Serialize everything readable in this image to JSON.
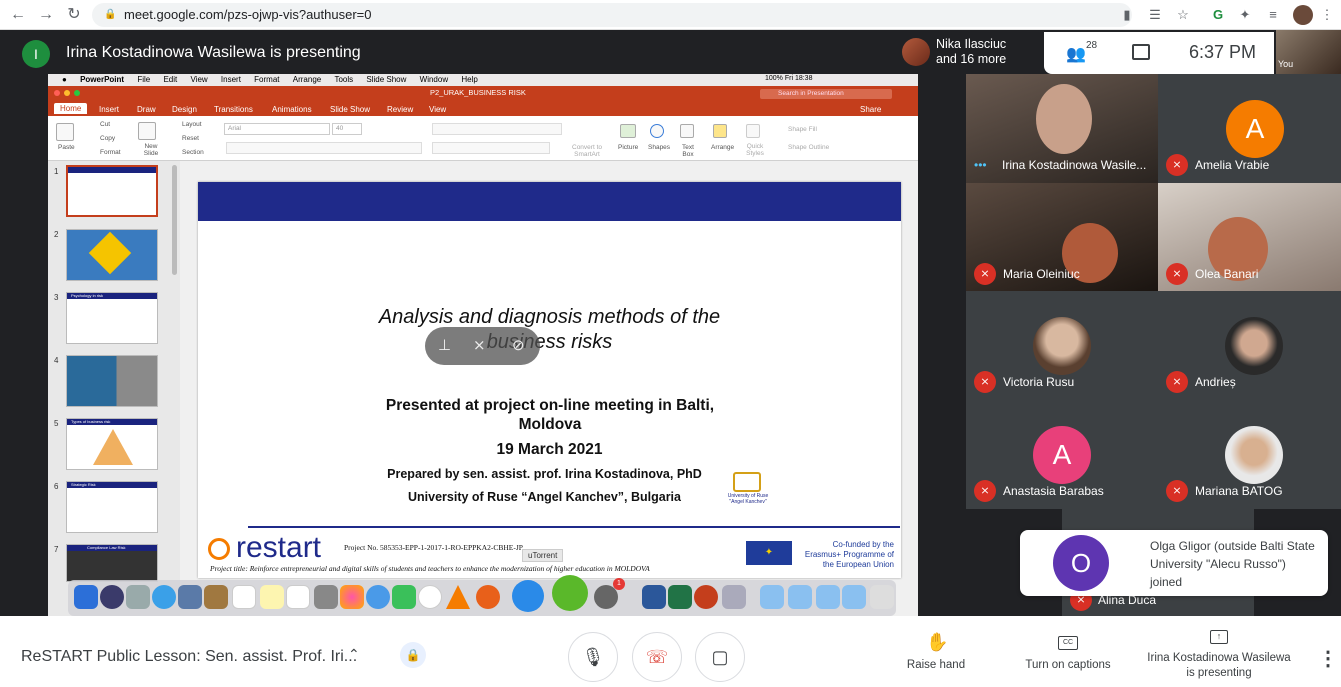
{
  "browser": {
    "url": "meet.google.com/pzs-ojwp-vis?authuser=0"
  },
  "meet": {
    "presenter_initial": "I",
    "presenter_banner": "Irina Kostadinowa Wasilewa is presenting",
    "other_participant": "Nika Ilasciuc",
    "others_more": "and 16 more",
    "people_count": "28",
    "time": "6:37 PM",
    "self_label": "You"
  },
  "powerpoint": {
    "menubar": [
      "PowerPoint",
      "File",
      "Edit",
      "View",
      "Insert",
      "Format",
      "Arrange",
      "Tools",
      "Slide Show",
      "Window",
      "Help"
    ],
    "menubar_right": "100% Fri 18:38",
    "doc_title": "P2_URAK_BUSINESS RISK",
    "search_placeholder": "Search in Presentation",
    "share": "Share",
    "tabs": [
      "Home",
      "Insert",
      "Draw",
      "Design",
      "Transitions",
      "Animations",
      "Slide Show",
      "Review",
      "View"
    ],
    "ribbon": {
      "paste": "Paste",
      "cut": "Cut",
      "copy": "Copy",
      "format": "Format",
      "new_slide": "New Slide",
      "layout": "Layout",
      "reset": "Reset",
      "section": "Section",
      "font": "Arial",
      "font_size": "40",
      "convert": "Convert to SmartArt",
      "picture": "Picture",
      "shapes": "Shapes",
      "textbox": "Text Box",
      "arrange": "Arrange",
      "quick_styles": "Quick Styles",
      "shape_fill": "Shape Fill",
      "shape_outline": "Shape Outline"
    },
    "thumb_numbers": [
      "1",
      "2",
      "3",
      "4",
      "5",
      "6",
      "7"
    ],
    "thumb_captions": [
      "",
      "",
      "Psychology in risk",
      "",
      "Types of business risk",
      "Strategic Risk",
      "Compliance Law Risk"
    ]
  },
  "slide": {
    "title_line1": "Analysis and diagnosis methods of the",
    "title_line2": "business risks",
    "presented_at": "Presented at project on-line meeting in Balti, Moldova",
    "date": "19 March 2021",
    "prepared_by": "Prepared by sen. assist. prof. Irina Kostadinova, PhD",
    "university": "University of Ruse “Angel Kanchev”, Bulgaria",
    "univ_logo_text": "University of Ruse \"Angel Kanchev\"",
    "restart_logo": "restart",
    "project_no": "Project No. 585353-EPP-1-2017-1-RO-EPPKA2-CBHE-JP",
    "project_title": "Project title: Reinforce entrepreneurial and digital skills of students and teachers to enhance the modernization of higher education in MOLDOVA",
    "eu_text": "Co-funded by the Erasmus+ Programme of the European Union"
  },
  "dock": {
    "tooltip": "uTorrent",
    "badge": "1"
  },
  "participants": [
    {
      "name": "Irina Kostadinowa Wasile...",
      "type": "photo"
    },
    {
      "name": "Amelia Vrabie",
      "type": "letter",
      "letter": "A",
      "color": "#f57c00"
    },
    {
      "name": "Maria Oleiniuc",
      "type": "photo"
    },
    {
      "name": "Olea Banari",
      "type": "photo"
    },
    {
      "name": "Victoria Rusu",
      "type": "avatar"
    },
    {
      "name": "Andrieș",
      "type": "avatar"
    },
    {
      "name": "Anastasia Barabas",
      "type": "letter",
      "letter": "A",
      "color": "#e8407a"
    },
    {
      "name": "Mariana BATOG",
      "type": "avatar"
    },
    {
      "name": "Alina Duca",
      "type": "hidden"
    }
  ],
  "toast": {
    "letter": "O",
    "text": "Olga Gligor (outside Balti State University \"Alecu Russo\") joined"
  },
  "bottom": {
    "meeting_title": "ReSTART Public Lesson: Sen. assist. Prof. Iri...",
    "raise_hand": "Raise hand",
    "captions": "Turn on captions",
    "presenting_line1": "Irina Kostadinowa Wasilewa",
    "presenting_line2": "is presenting"
  },
  "colors": {
    "meet_bg": "#202124",
    "ppt_red": "#c43e1c",
    "slide_blue": "#1f2a8a",
    "mic_off": "#d93025",
    "hangup": "#d93025"
  }
}
